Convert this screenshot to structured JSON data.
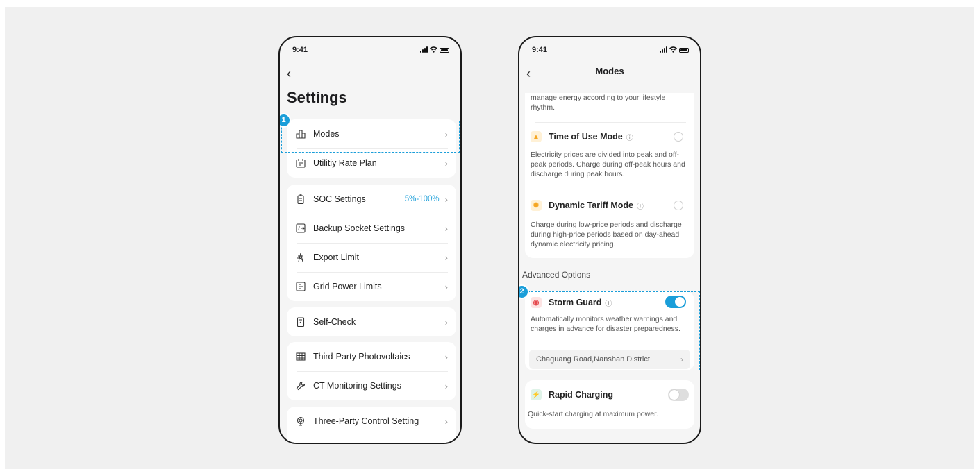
{
  "left_phone": {
    "status_time": "9:41",
    "back_icon": "chevron-left-icon",
    "title": "Settings",
    "badge": "1",
    "groups": [
      [
        {
          "label": "Modes",
          "icon": "modes-icon",
          "value": ""
        },
        {
          "label": "Utilitiy Rate Plan",
          "icon": "rate-plan-icon",
          "value": ""
        }
      ],
      [
        {
          "label": "SOC Settings",
          "icon": "battery-icon",
          "value": "5%-100%"
        },
        {
          "label": "Backup Socket Settings",
          "icon": "socket-icon",
          "value": ""
        },
        {
          "label": "Export Limit",
          "icon": "tower-icon",
          "value": ""
        },
        {
          "label": "Grid Power Limits",
          "icon": "grid-limit-icon",
          "value": ""
        }
      ],
      [
        {
          "label": "Self-Check",
          "icon": "self-check-icon",
          "value": ""
        }
      ],
      [
        {
          "label": "Third-Party Photovoltaics",
          "icon": "solar-panel-icon",
          "value": ""
        },
        {
          "label": "CT Monitoring Settings",
          "icon": "wrench-icon",
          "value": ""
        }
      ],
      [
        {
          "label": "Three-Party Control Setting",
          "icon": "antenna-icon",
          "value": ""
        }
      ]
    ]
  },
  "right_phone": {
    "status_time": "9:41",
    "title": "Modes",
    "top_desc": "manage energy according to your lifestyle rhythm.",
    "time_of_use": {
      "label": "Time of Use Mode",
      "desc": "Electricity prices are divided into peak and off-peak periods. Charge during off-peak hours and discharge during peak hours.",
      "selected": false,
      "icon_color": "#f5a623"
    },
    "dynamic_tariff": {
      "label": "Dynamic Tariff Mode",
      "desc": "Charge during low-price periods and discharge during high-price periods based on day-ahead dynamic electricity pricing.",
      "selected": false,
      "icon_color": "#f5a623"
    },
    "advanced_label": "Advanced Options",
    "badge": "2",
    "storm_guard": {
      "label": "Storm Guard",
      "desc": "Automatically monitors weather warnings and charges in advance for disaster preparedness.",
      "enabled": true,
      "address": "Chaguang Road,Nanshan District",
      "icon_color": "#e5484d"
    },
    "rapid_charging": {
      "label": "Rapid Charging",
      "desc": "Quick-start charging at maximum power.",
      "enabled": false,
      "icon_color": "#2fb36b"
    }
  },
  "colors": {
    "accent": "#1a9ed9",
    "background": "#f0f0f0"
  }
}
